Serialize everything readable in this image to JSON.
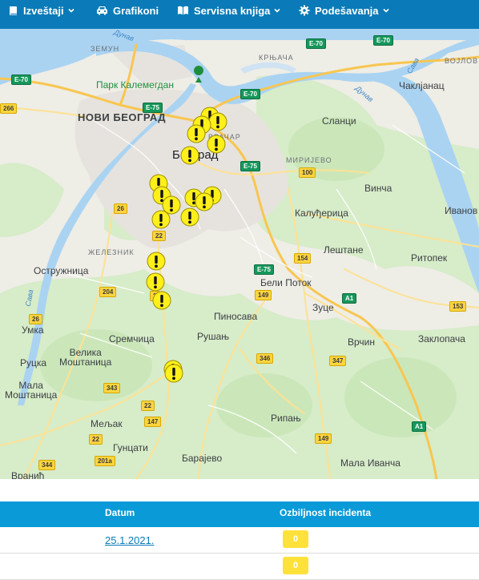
{
  "nav": {
    "items": [
      {
        "label": "Izveštaji",
        "icon": "book-icon",
        "dropdown": true
      },
      {
        "label": "Grafikoni",
        "icon": "car-icon",
        "dropdown": false
      },
      {
        "label": "Servisna knjiga",
        "icon": "open-book-icon",
        "dropdown": true
      },
      {
        "label": "Podešavanja",
        "icon": "gear-icon",
        "dropdown": true
      }
    ]
  },
  "map": {
    "labels": {
      "zemun": "ЗЕМУН",
      "krnjaca": "КРЊАЧА",
      "vojlovica": "ВОЈЛОВ",
      "park": "Парк Калемегдан",
      "novi_beograd": "НОВИ БЕОГРАД",
      "vracar": "ВРАЧАР",
      "beograd": "Београд",
      "slanci": "Сланци",
      "cakljanac": "Чаклјанац",
      "mirijevo": "МИРИЈЕВО",
      "vinca": "Винча",
      "ivanovo": "Иванов",
      "kaludjerica": "Калуђерица",
      "zeleznik": "ЖЕЛЕЗНИК",
      "ostruznica": "Остружница",
      "lestane": "Лештане",
      "ritopek": "Ритопек",
      "beli_potok": "Бели Поток",
      "pinosava": "Пиносава",
      "zuce": "Зуце",
      "umka": "Умка",
      "rusanj": "Рушањ",
      "sremcica": "Сремчица",
      "velika_mostanica": "Велика\nМоштаница",
      "vrcin": "Врчин",
      "zaklopaca": "Заклопача",
      "rucka": "Руцка",
      "mala_mostanica": "Мала\nМоштаница",
      "ripanj": "Рипањ",
      "meljak": "Мељак",
      "guncati": "Гунцати",
      "barajevo": "Барајево",
      "mala_ivanca": "Мала Иванча",
      "vranic": "Вранић",
      "dunav": "Дунав",
      "dunav2": "Дунав",
      "sava": "Сава",
      "sava2": "Сава"
    },
    "shields": {
      "e70_left": "E-70",
      "e70_top": "E-70",
      "e70_right": "E-70",
      "e75_top": "E-75",
      "e70_center": "E-70",
      "e75_mid": "E-75",
      "e75_low": "E-75",
      "r266": "266",
      "r26": "26",
      "r22a": "22",
      "r100": "100",
      "r154": "154",
      "r149a": "149",
      "a1a": "A1",
      "r204": "204",
      "r26b": "26",
      "r153": "153",
      "r346": "346",
      "r347": "347",
      "r343": "343",
      "r22b": "22",
      "r147": "147",
      "r22c": "22",
      "a1b": "A1",
      "r149b": "149",
      "r201a": "201a",
      "r344": "344",
      "r2": "2"
    },
    "marker_icon": "warning-marker-icon",
    "marker_color": "#ffef1a"
  },
  "table": {
    "headers": [
      "Datum",
      "Ozbiljnost incidenta"
    ],
    "rows": [
      {
        "date": "25.1.2021.",
        "severity": "0"
      },
      {
        "date": "",
        "severity": "0"
      }
    ]
  },
  "colors": {
    "navbar": "#0a7bb8",
    "table_header": "#0a9ad8",
    "severity_badge": "#ffe13b",
    "water": "#aad3f2"
  }
}
